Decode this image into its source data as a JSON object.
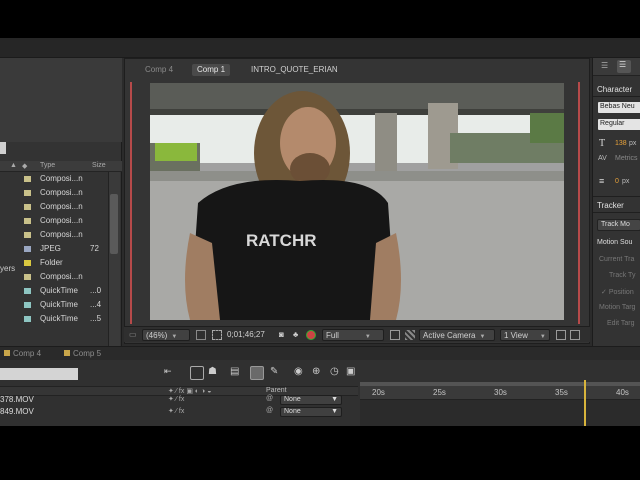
{
  "comp_tabs": [
    "Comp 4",
    "Comp 1",
    "INTRO_QUOTE_ERIAN"
  ],
  "project": {
    "columns": {
      "type": "Type",
      "size": "Size"
    },
    "side_label": "yers",
    "rows": [
      {
        "type": "Composi...n",
        "size": "",
        "color": "#c9c18a"
      },
      {
        "type": "Composi...n",
        "size": "",
        "color": "#c9c18a"
      },
      {
        "type": "Composi...n",
        "size": "",
        "color": "#c9c18a"
      },
      {
        "type": "Composi...n",
        "size": "",
        "color": "#c9c18a"
      },
      {
        "type": "Composi...n",
        "size": "",
        "color": "#c9c18a"
      },
      {
        "type": "JPEG",
        "size": "72",
        "color": "#9aa7c2"
      },
      {
        "type": "Folder",
        "size": "",
        "color": "#d9c840"
      },
      {
        "type": "Composi...n",
        "size": "",
        "color": "#c9c18a"
      },
      {
        "type": "QuickTime",
        "size": "...0",
        "color": "#8ec6c2"
      },
      {
        "type": "QuickTime",
        "size": "...4",
        "color": "#8ec6c2"
      },
      {
        "type": "QuickTime",
        "size": "...5",
        "color": "#8ec6c2"
      }
    ]
  },
  "viewer": {
    "zoom": "(46%)",
    "timecode": "0;01;46;27",
    "resolution": "Full",
    "camera": "Active Camera",
    "views": "1 View"
  },
  "video": {
    "shirt_text": "RATCHR"
  },
  "right_panel": {
    "character_title": "Character",
    "font_name": "Bebas Neu",
    "font_style": "Regular",
    "font_size_value": "138",
    "font_size_unit": "px",
    "metrics_label": "Metrics",
    "stroke_value": "0",
    "stroke_unit": "px",
    "tracker_title": "Tracker",
    "track_motion": "Track Mo",
    "motion_source": "Motion Sou",
    "current_track": "Current Tra",
    "track_type": "Track Ty",
    "position": "Position",
    "motion_target": "Motion Targ",
    "edit_target": "Edit Targ"
  },
  "bottom_tabs": [
    "Comp 4",
    "Comp 5"
  ],
  "timeline": {
    "parent_label": "Parent",
    "ruler": [
      "20s",
      "25s",
      "30s",
      "35s",
      "40s"
    ],
    "layers": [
      {
        "name": "378.MOV",
        "parent": "None"
      },
      {
        "name": "849.MOV",
        "parent": "None"
      }
    ]
  }
}
